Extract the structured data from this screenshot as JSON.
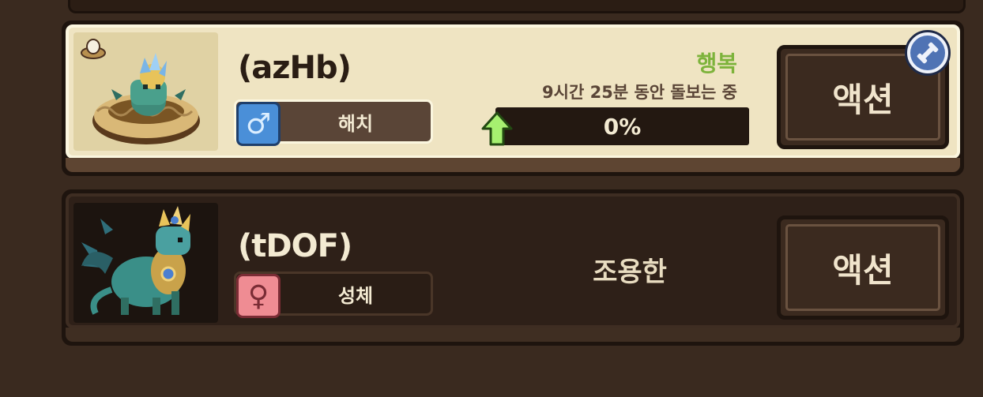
{
  "pets": [
    {
      "name": "(azHb)",
      "gender": "male",
      "gender_symbol": "♂",
      "stage": "해치",
      "mood": "행복",
      "timer": "9시간 25분 동안 돌보는 중",
      "progress_text": "0%",
      "progress_value": 0,
      "action_label": "액션"
    },
    {
      "name": "(tDOF)",
      "gender": "female",
      "gender_symbol": "♀",
      "stage": "성체",
      "mood": "조용한",
      "action_label": "액션"
    }
  ],
  "colors": {
    "happy": "#7db33b",
    "male": "#4a8fd8",
    "female": "#ef8c93",
    "badge": "#4f73b4"
  }
}
